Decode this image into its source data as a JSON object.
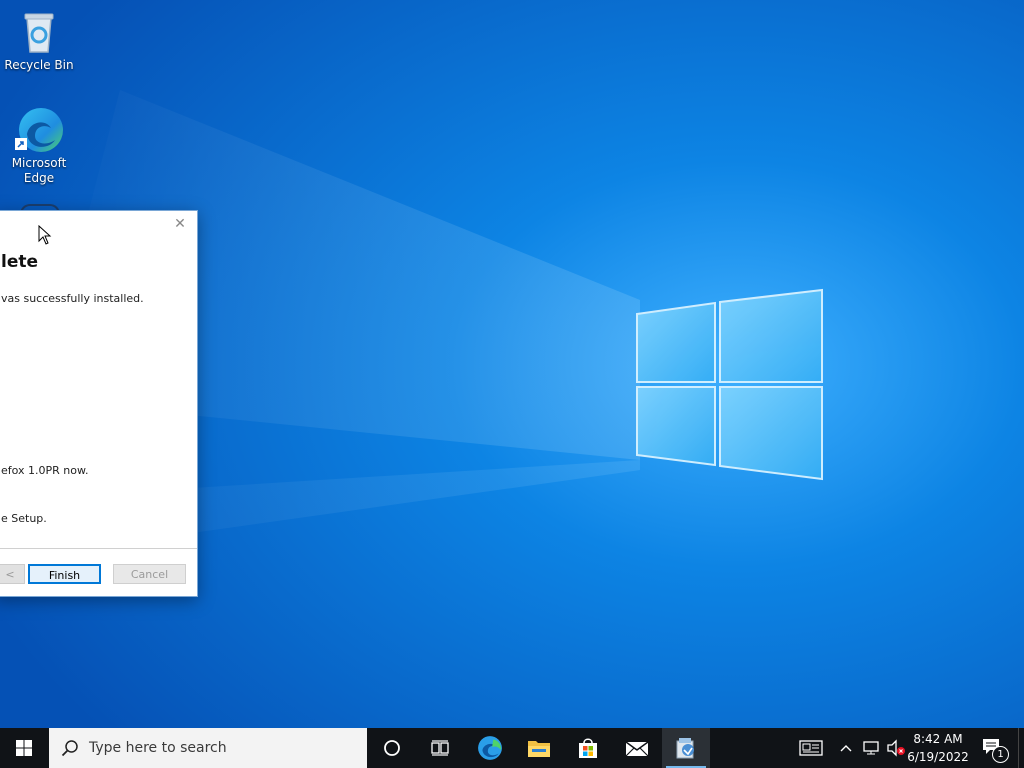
{
  "desktop": {
    "icons": [
      {
        "label": "Recycle Bin",
        "icon": "recycle-bin-icon"
      },
      {
        "label_line1": "Microsoft",
        "label_line2": "Edge",
        "icon": "edge-icon"
      }
    ]
  },
  "dialog": {
    "heading": "lete",
    "line1": "vas successfully installed.",
    "line2": "efox 1.0PR now.",
    "line3": "e Setup.",
    "back_label": "<",
    "finish_label": "Finish",
    "cancel_label": "Cancel",
    "close_glyph": "✕"
  },
  "taskbar": {
    "search_placeholder": "Type here to search",
    "time": "8:42 AM",
    "date": "6/19/2022",
    "notification_count": "1",
    "pinned": [
      "cortana-icon",
      "task-view-icon",
      "edge-icon",
      "file-explorer-icon",
      "store-icon",
      "mail-icon",
      "installer-app-icon"
    ]
  },
  "colors": {
    "accent": "#0078d7",
    "taskbar": "#101317",
    "wallpaper": "#0a6fd6"
  }
}
